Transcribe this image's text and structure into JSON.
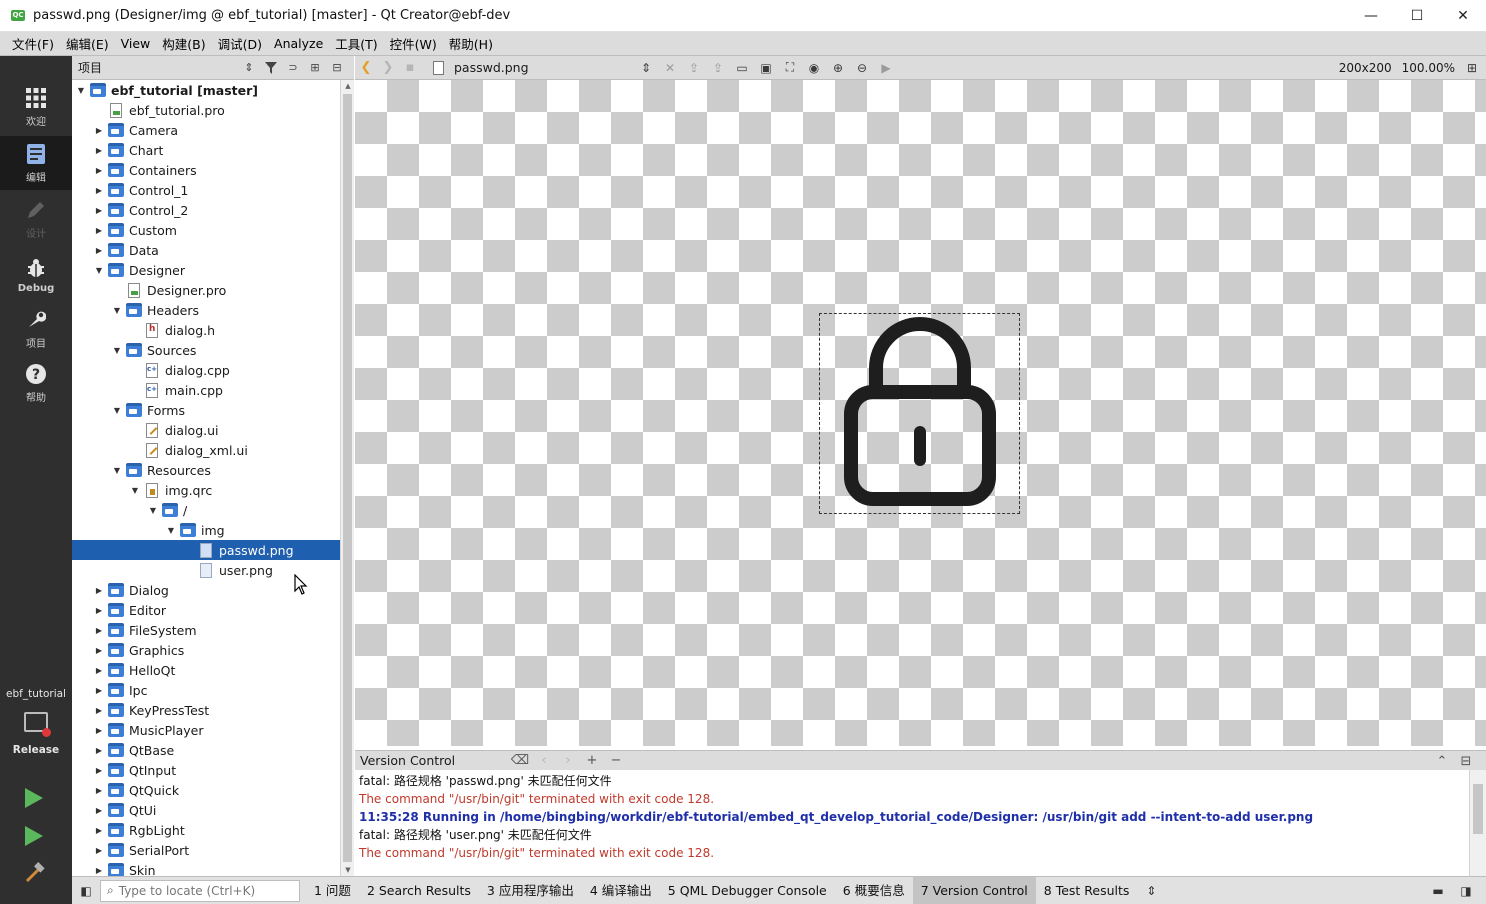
{
  "window": {
    "title": "passwd.png (Designer/img @ ebf_tutorial) [master] - Qt Creator@ebf-dev",
    "app_icon": "QC",
    "minimize": "—",
    "maximize": "☐",
    "close": "✕"
  },
  "menu": [
    "文件(F)",
    "编辑(E)",
    "View",
    "构建(B)",
    "调试(D)",
    "Analyze",
    "工具(T)",
    "控件(W)",
    "帮助(H)"
  ],
  "modes": {
    "welcome": "欢迎",
    "edit": "编辑",
    "design": "设计",
    "debug": "Debug",
    "projects": "项目",
    "help": "帮助"
  },
  "kit": {
    "project": "ebf_tutorial",
    "build": "Release"
  },
  "project_panel": {
    "label": "项目"
  },
  "tree": [
    {
      "label": "ebf_tutorial [master]",
      "depth": 0,
      "expanded": true,
      "icon": "folder",
      "bold": true
    },
    {
      "label": "ebf_tutorial.pro",
      "depth": 1,
      "icon": "pro"
    },
    {
      "label": "Camera",
      "depth": 1,
      "expanded": false,
      "icon": "folder"
    },
    {
      "label": "Chart",
      "depth": 1,
      "expanded": false,
      "icon": "folder"
    },
    {
      "label": "Containers",
      "depth": 1,
      "expanded": false,
      "icon": "folder"
    },
    {
      "label": "Control_1",
      "depth": 1,
      "expanded": false,
      "icon": "folder"
    },
    {
      "label": "Control_2",
      "depth": 1,
      "expanded": false,
      "icon": "folder"
    },
    {
      "label": "Custom",
      "depth": 1,
      "expanded": false,
      "icon": "folder"
    },
    {
      "label": "Data",
      "depth": 1,
      "expanded": false,
      "icon": "folder"
    },
    {
      "label": "Designer",
      "depth": 1,
      "expanded": true,
      "icon": "folder"
    },
    {
      "label": "Designer.pro",
      "depth": 2,
      "icon": "pro"
    },
    {
      "label": "Headers",
      "depth": 2,
      "expanded": true,
      "icon": "folder"
    },
    {
      "label": "dialog.h",
      "depth": 3,
      "icon": "hdr"
    },
    {
      "label": "Sources",
      "depth": 2,
      "expanded": true,
      "icon": "folder"
    },
    {
      "label": "dialog.cpp",
      "depth": 3,
      "icon": "cpp"
    },
    {
      "label": "main.cpp",
      "depth": 3,
      "icon": "cpp"
    },
    {
      "label": "Forms",
      "depth": 2,
      "expanded": true,
      "icon": "folder"
    },
    {
      "label": "dialog.ui",
      "depth": 3,
      "icon": "ui"
    },
    {
      "label": "dialog_xml.ui",
      "depth": 3,
      "icon": "ui"
    },
    {
      "label": "Resources",
      "depth": 2,
      "expanded": true,
      "icon": "folder"
    },
    {
      "label": "img.qrc",
      "depth": 3,
      "expanded": true,
      "icon": "qrc"
    },
    {
      "label": "/",
      "depth": 4,
      "expanded": true,
      "icon": "folder"
    },
    {
      "label": "img",
      "depth": 5,
      "expanded": true,
      "icon": "folder"
    },
    {
      "label": "passwd.png",
      "depth": 6,
      "icon": "png",
      "selected": true
    },
    {
      "label": "user.png",
      "depth": 6,
      "icon": "png"
    },
    {
      "label": "Dialog",
      "depth": 1,
      "expanded": false,
      "icon": "folder"
    },
    {
      "label": "Editor",
      "depth": 1,
      "expanded": false,
      "icon": "folder"
    },
    {
      "label": "FileSystem",
      "depth": 1,
      "expanded": false,
      "icon": "folder"
    },
    {
      "label": "Graphics",
      "depth": 1,
      "expanded": false,
      "icon": "folder"
    },
    {
      "label": "HelloQt",
      "depth": 1,
      "expanded": false,
      "icon": "folder"
    },
    {
      "label": "Ipc",
      "depth": 1,
      "expanded": false,
      "icon": "folder"
    },
    {
      "label": "KeyPressTest",
      "depth": 1,
      "expanded": false,
      "icon": "folder"
    },
    {
      "label": "MusicPlayer",
      "depth": 1,
      "expanded": false,
      "icon": "folder"
    },
    {
      "label": "QtBase",
      "depth": 1,
      "expanded": false,
      "icon": "folder"
    },
    {
      "label": "QtInput",
      "depth": 1,
      "expanded": false,
      "icon": "folder"
    },
    {
      "label": "QtQuick",
      "depth": 1,
      "expanded": false,
      "icon": "folder"
    },
    {
      "label": "QtUi",
      "depth": 1,
      "expanded": false,
      "icon": "folder"
    },
    {
      "label": "RgbLight",
      "depth": 1,
      "expanded": false,
      "icon": "folder"
    },
    {
      "label": "SerialPort",
      "depth": 1,
      "expanded": false,
      "icon": "folder"
    },
    {
      "label": "Skin",
      "depth": 1,
      "expanded": false,
      "icon": "folder"
    }
  ],
  "editor": {
    "document": "passwd.png",
    "image_size": "200x200",
    "zoom": "100.00%"
  },
  "output": {
    "title": "Version Control",
    "lines": [
      {
        "text": "fatal: 路径规格 'passwd.png' 未匹配任何文件",
        "kind": "plain"
      },
      {
        "text": "The command \"/usr/bin/git\" terminated with exit code 128.",
        "kind": "err"
      },
      {
        "text": "11:35:28 Running in /home/bingbing/workdir/ebf-tutorial/embed_qt_develop_tutorial_code/Designer: /usr/bin/git add --intent-to-add user.png",
        "kind": "info"
      },
      {
        "text": "fatal: 路径规格 'user.png' 未匹配任何文件",
        "kind": "plain"
      },
      {
        "text": "The command \"/usr/bin/git\" terminated with exit code 128.",
        "kind": "err"
      }
    ]
  },
  "statusbar": {
    "locator_placeholder": "Type to locate (Ctrl+K)",
    "tabs": [
      {
        "label": "1 问题"
      },
      {
        "label": "2 Search Results"
      },
      {
        "label": "3 应用程序输出"
      },
      {
        "label": "4 编译输出"
      },
      {
        "label": "5 QML Debugger Console"
      },
      {
        "label": "6 概要信息"
      },
      {
        "label": "7 Version Control",
        "active": true
      },
      {
        "label": "8 Test Results"
      }
    ]
  },
  "colors": {
    "selection": "#1f5fb0",
    "modebar": "#2f2f2f",
    "error_text": "#c0392b",
    "info_text": "#1f2fa8"
  }
}
